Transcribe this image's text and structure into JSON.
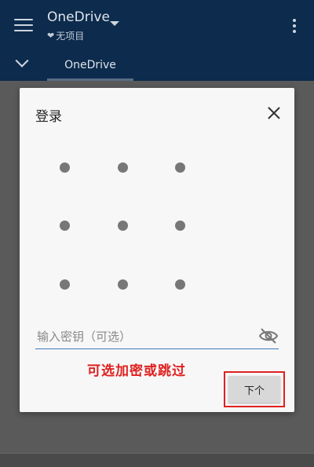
{
  "appbar": {
    "title": "OneDrive",
    "subtitle_text": "无项目",
    "tab_label": "OneDrive"
  },
  "dialog": {
    "title": "登录",
    "pattern_dots": 9,
    "password": {
      "value": "",
      "placeholder": "输入密钥（可选）"
    },
    "annotation": "可选加密或跳过",
    "next_label": "下个"
  },
  "colors": {
    "appbar_bg": "#0c2b4d",
    "overlay_bg": "#5a5a5a",
    "dialog_bg": "#f7f7f7",
    "accent_underline": "#3a78c2",
    "annotation_red": "#e02020"
  },
  "icons": [
    "menu-icon",
    "heart-icon",
    "caret-down-icon",
    "more-vert-icon",
    "chevron-down-icon",
    "close-icon",
    "eye-off-icon"
  ]
}
